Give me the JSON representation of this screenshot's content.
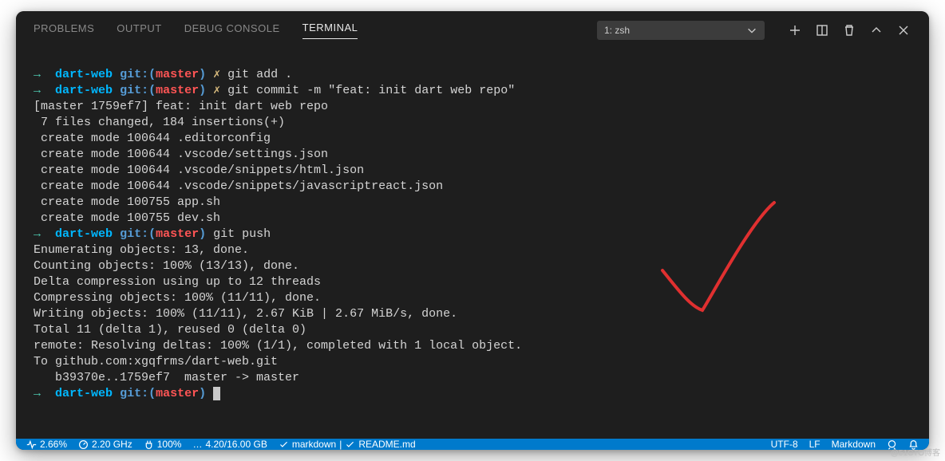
{
  "panel": {
    "tabs": {
      "problems": "PROBLEMS",
      "output": "OUTPUT",
      "debug": "DEBUG CONSOLE",
      "terminal": "TERMINAL"
    },
    "terminal_select": "1: zsh"
  },
  "prompt": {
    "arrow_ok": "→",
    "dir": "dart-web",
    "git_label": "git:(",
    "branch": "master",
    "git_close": ")",
    "dirty": "✗"
  },
  "lines": {
    "cmd1": "git add .",
    "cmd2": "git commit -m \"feat: init dart web repo\"",
    "out1": "[master 1759ef7] feat: init dart web repo",
    "out2": " 7 files changed, 184 insertions(+)",
    "out3": " create mode 100644 .editorconfig",
    "out4": " create mode 100644 .vscode/settings.json",
    "out5": " create mode 100644 .vscode/snippets/html.json",
    "out6": " create mode 100644 .vscode/snippets/javascriptreact.json",
    "out7": " create mode 100755 app.sh",
    "out8": " create mode 100755 dev.sh",
    "cmd3": "git push",
    "out9": "Enumerating objects: 13, done.",
    "out10": "Counting objects: 100% (13/13), done.",
    "out11": "Delta compression using up to 12 threads",
    "out12": "Compressing objects: 100% (11/11), done.",
    "out13": "Writing objects: 100% (11/11), 2.67 KiB | 2.67 MiB/s, done.",
    "out14": "Total 11 (delta 1), reused 0 (delta 0)",
    "out15": "remote: Resolving deltas: 100% (1/1), completed with 1 local object.",
    "out16": "To github.com:xgqfrms/dart-web.git",
    "out17": "   b39370e..1759ef7  master -> master"
  },
  "statusbar": {
    "cpu_pct": "2.66%",
    "cpu_ghz": "2.20 GHz",
    "battery": "100%",
    "memory": "4.20/16.00 GB",
    "ellipsis": "…",
    "language_check": "markdown",
    "file_check": "README.md",
    "encoding": "UTF-8",
    "eol": "LF",
    "mode": "Markdown"
  },
  "watermark": "@51CTO博客"
}
